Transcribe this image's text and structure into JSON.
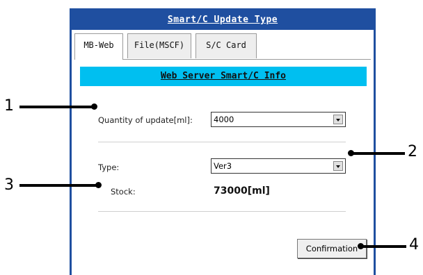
{
  "dialog": {
    "title": "Smart/C Update Type",
    "tabs": [
      {
        "label": "MB-Web",
        "active": true
      },
      {
        "label": "File(MSCF)",
        "active": false
      },
      {
        "label": "S/C Card",
        "active": false
      }
    ],
    "banner": "Web Server Smart/C Info",
    "quantity": {
      "label": "Quantity of update[ml]:",
      "value": "4000"
    },
    "type": {
      "label": "Type:",
      "value": "Ver3"
    },
    "stock": {
      "label": "Stock:",
      "value": "73000[ml]"
    },
    "confirm_label": "Confirmation"
  },
  "callouts": [
    "1",
    "2",
    "3",
    "4"
  ],
  "colors": {
    "titlebar": "#1f4fa0",
    "banner": "#00bff0"
  }
}
